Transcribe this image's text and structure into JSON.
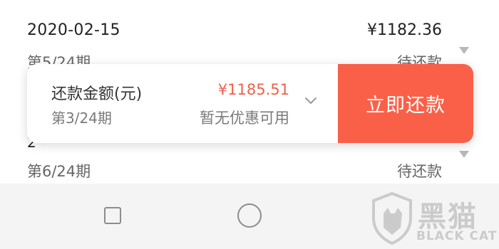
{
  "list": {
    "row1": {
      "date": "2020-02-15",
      "amount": "¥1182.36",
      "period": "第5/24期",
      "status": "待还款"
    },
    "row2": {
      "date_partial": "2",
      "period": "第6/24期",
      "status": "待还款"
    }
  },
  "pay_bar": {
    "title": "还款金额(元)",
    "period": "第3/24期",
    "amount": "¥1185.51",
    "discount": "暂无优惠可用",
    "button_label": "立即还款"
  },
  "watermark": {
    "brand": "黑猫",
    "brand_en": "BLACK CAT"
  },
  "colors": {
    "accent": "#fa6048",
    "amount_red": "#f0604a"
  },
  "icons": {
    "expand": "chevron-down-icon",
    "row_expand": "triangle-down-icon",
    "nav_recent": "square-icon",
    "nav_home": "circle-icon"
  }
}
